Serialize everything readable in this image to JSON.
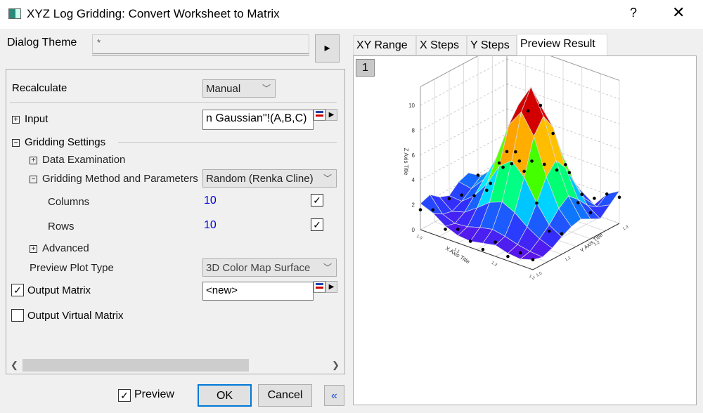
{
  "window": {
    "title": "XYZ Log Gridding: Convert Worksheet to Matrix",
    "help": "?",
    "close": "✕"
  },
  "dialog_theme": {
    "label": "Dialog Theme",
    "value": "*",
    "arrow": "▸"
  },
  "form": {
    "recalculate": {
      "label": "Recalculate",
      "value": "Manual"
    },
    "input": {
      "label": "Input",
      "value": "n Gaussian\"!(A,B,C)"
    },
    "gridding_settings": {
      "label": "Gridding Settings"
    },
    "data_examination": {
      "label": "Data Examination"
    },
    "gridding_method": {
      "label": "Gridding Method and Parameters",
      "value": "Random (Renka Cline)"
    },
    "columns": {
      "label": "Columns",
      "value": "10",
      "checked": true
    },
    "rows": {
      "label": "Rows",
      "value": "10",
      "checked": true
    },
    "advanced": {
      "label": "Advanced"
    },
    "preview_plot_type": {
      "label": "Preview Plot Type",
      "value": "3D Color Map Surface"
    },
    "output_matrix": {
      "label": "Output Matrix",
      "checked": true,
      "value": "<new>"
    },
    "output_virtual_matrix": {
      "label": "Output Virtual Matrix",
      "checked": false
    }
  },
  "bottom": {
    "preview_label": "Preview",
    "preview_checked": true,
    "ok": "OK",
    "cancel": "Cancel",
    "collapse": "«"
  },
  "tabs": [
    {
      "label": "XY Range"
    },
    {
      "label": "X Steps"
    },
    {
      "label": "Y Steps"
    },
    {
      "label": "Preview Result",
      "active": true
    }
  ],
  "preview": {
    "layer_button": "1"
  },
  "chart_data": {
    "type": "3d-surface",
    "xlabel": "X Axis Title",
    "ylabel": "Y Axis Title",
    "zlabel": "Z Axis Title",
    "x_ticks": [
      "1.0",
      "1.1",
      "1.2",
      "1.3"
    ],
    "y_ticks": [
      "1.0",
      "1.1",
      "1.2",
      "1.3"
    ],
    "z_ticks": [
      "0",
      "2",
      "4",
      "6",
      "8",
      "10"
    ],
    "xlim": [
      1.0,
      1.3
    ],
    "ylim": [
      1.0,
      1.3
    ],
    "zlim": [
      0,
      11.5
    ],
    "colormap": "rainbow",
    "z": [
      [
        2.1,
        2.4,
        1.8,
        1.5,
        2.2,
        2.5,
        1.9,
        1.6,
        2.0,
        2.3
      ],
      [
        1.7,
        1.2,
        1.0,
        1.4,
        2.0,
        2.6,
        2.1,
        1.3,
        1.8,
        2.4
      ],
      [
        1.0,
        0.8,
        1.3,
        2.2,
        3.1,
        3.6,
        3.0,
        2.0,
        1.5,
        2.0
      ],
      [
        0.6,
        0.9,
        2.0,
        3.5,
        5.2,
        6.0,
        5.1,
        3.4,
        2.1,
        2.6
      ],
      [
        0.5,
        1.2,
        2.8,
        5.3,
        8.2,
        9.4,
        8.0,
        5.0,
        2.7,
        3.0
      ],
      [
        0.7,
        1.4,
        3.2,
        6.1,
        9.6,
        11.2,
        9.3,
        6.0,
        3.0,
        2.4
      ],
      [
        0.9,
        1.2,
        2.7,
        5.1,
        8.0,
        9.2,
        7.9,
        5.2,
        2.6,
        1.5
      ],
      [
        0.6,
        0.9,
        1.9,
        3.4,
        5.1,
        6.0,
        5.0,
        3.3,
        1.7,
        0.8
      ],
      [
        0.5,
        0.7,
        1.3,
        2.0,
        2.9,
        3.5,
        2.8,
        1.9,
        1.4,
        2.0
      ],
      [
        0.8,
        0.6,
        0.9,
        1.4,
        1.8,
        2.0,
        1.6,
        1.2,
        1.9,
        2.6
      ]
    ]
  }
}
